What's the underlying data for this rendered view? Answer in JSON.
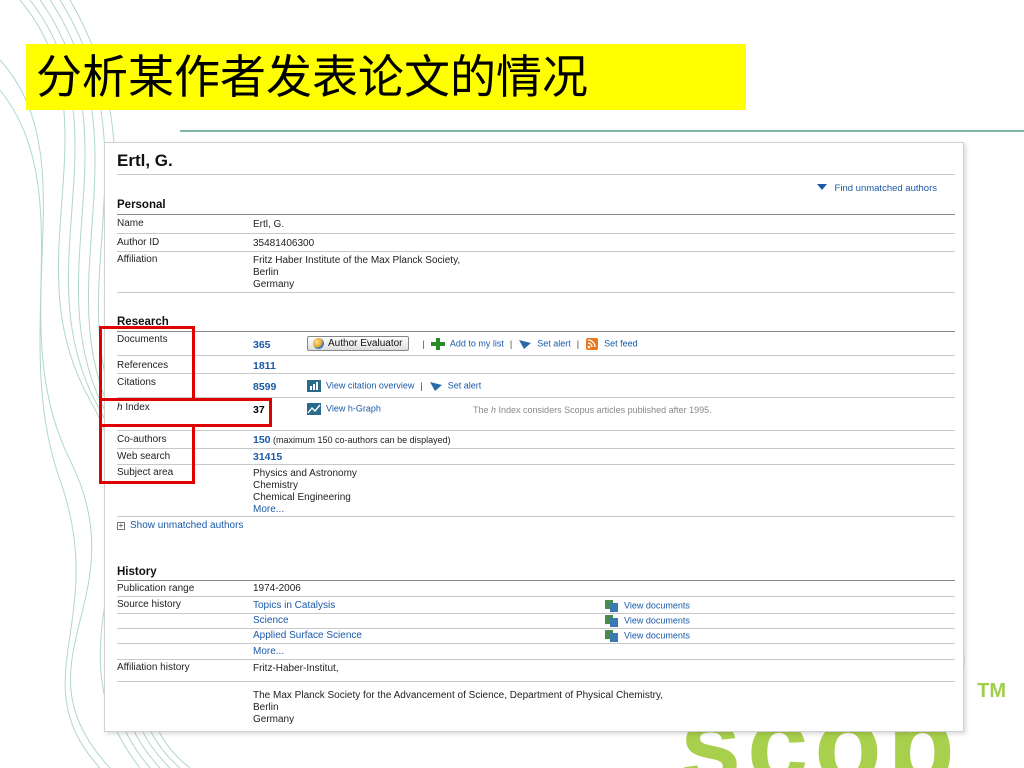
{
  "slide": {
    "title": "分析某作者发表论文的情况"
  },
  "profile": {
    "author_name": "Ertl, G.",
    "find_unmatched": "Find unmatched authors",
    "personal": {
      "heading": "Personal",
      "name_label": "Name",
      "name_value": "Ertl, G.",
      "author_id_label": "Author ID",
      "author_id_value": "35481406300",
      "affiliation_label": "Affiliation",
      "affiliation_lines": [
        "Fritz Haber Institute of the Max Planck Society,",
        "Berlin",
        "Germany"
      ]
    },
    "research": {
      "heading": "Research",
      "documents_label": "Documents",
      "documents_value": "365",
      "author_evaluator": "Author Evaluator",
      "add_to_list": "Add to my list",
      "set_alert": "Set alert",
      "set_feed": "Set feed",
      "references_label": "References",
      "references_value": "1811",
      "citations_label": "Citations",
      "citations_value": "8599",
      "view_citation_overview": "View citation overview",
      "citations_set_alert": "Set alert",
      "hindex_label_italic": "h",
      "hindex_label_rest": " Index",
      "hindex_value": "37",
      "view_hgraph": "View h-Graph",
      "hindex_note_pre": "The ",
      "hindex_note_italic": "h",
      "hindex_note_post": " Index considers Scopus articles published after 1995.",
      "coauthors_label": "Co-authors",
      "coauthors_value": "150",
      "coauthors_note": " (maximum 150 co-authors can be displayed)",
      "web_search_label": "Web search",
      "web_search_value": "31415",
      "subject_area_label": "Subject area",
      "subject_areas": [
        "Physics and Astronomy",
        "Chemistry",
        "Chemical Engineering"
      ],
      "subject_more": "More..."
    },
    "show_unmatched": "Show unmatched authors",
    "history": {
      "heading": "History",
      "publication_range_label": "Publication range",
      "publication_range_value": "1974-2006",
      "source_history_label": "Source history",
      "sources": [
        {
          "name": "Topics in Catalysis",
          "action": "View documents"
        },
        {
          "name": "Science",
          "action": "View documents"
        },
        {
          "name": "Applied Surface Science",
          "action": "View documents"
        }
      ],
      "source_more": "More...",
      "affiliation_history_label": "Affiliation history",
      "affiliation_history_first": "Fritz-Haber-Institut,",
      "affiliation_history_second": [
        "The Max Planck Society for the Advancement of Science, Department of Physical Chemistry,",
        "Berlin",
        "Germany"
      ]
    }
  },
  "colors": {
    "title_bg": "#ffff00",
    "link": "#1a5aa8",
    "highlight_box": "#e00000",
    "logo_green": "#a8d04c"
  }
}
